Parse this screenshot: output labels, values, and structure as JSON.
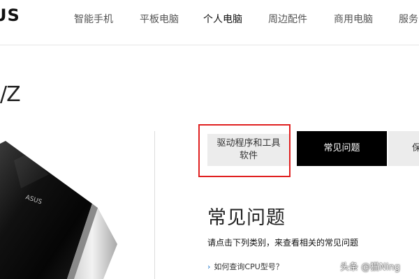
{
  "header": {
    "logo_text": "US",
    "nav_items": [
      {
        "label": "智能手机"
      },
      {
        "label": "平板电脑"
      },
      {
        "label": "个人电脑"
      },
      {
        "label": "周边配件"
      },
      {
        "label": "商用电脑"
      },
      {
        "label": "服务"
      }
    ],
    "active_index": 2
  },
  "product": {
    "title_fragment": "/Z",
    "image_logo_text": "ASUS"
  },
  "tabs": {
    "drivers_label": "驱动程序和工具软件",
    "faq_label": "常见问题",
    "warranty_label": "保"
  },
  "faq": {
    "heading": "常见问题",
    "subtitle": "请点击下列类别，来查看相关的常见问题",
    "links": [
      {
        "label": "如何查询CPU型号？"
      }
    ]
  },
  "watermark": "头条 @猫Ning",
  "colors": {
    "highlight": "#e02020",
    "active_tab_bg": "#000000",
    "inactive_tab_bg": "#ececec",
    "link_chevron": "#1a73c8"
  }
}
